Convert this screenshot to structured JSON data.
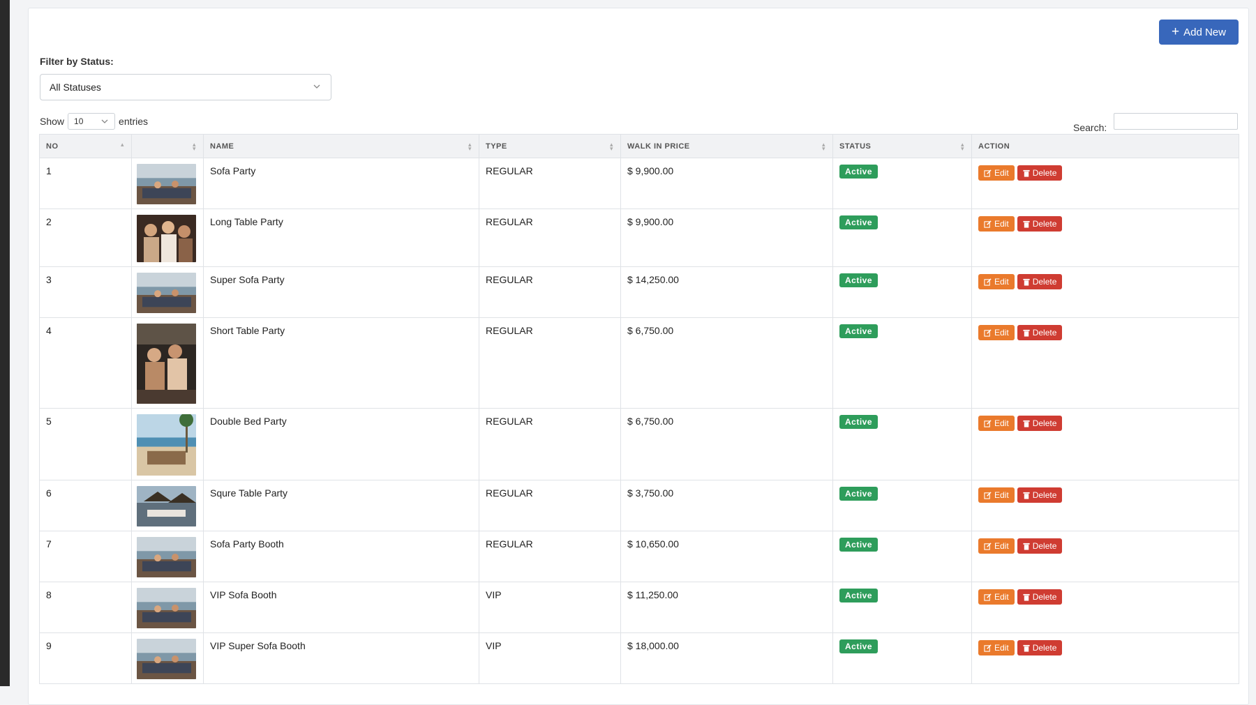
{
  "toolbar": {
    "add_label": "Add New"
  },
  "filter": {
    "label": "Filter by Status:",
    "selected": "All Statuses"
  },
  "length": {
    "show": "Show",
    "value": "10",
    "entries": "entries"
  },
  "search": {
    "label": "Search:"
  },
  "table": {
    "headers": [
      "NO",
      "",
      "NAME",
      "TYPE",
      "WALK IN PRICE",
      "STATUS",
      "ACTION"
    ],
    "edit_label": "Edit",
    "delete_label": "Delete",
    "rows": [
      {
        "no": "1",
        "name": "Sofa Party",
        "type": "REGULAR",
        "price": "$ 9,900.00",
        "status": "Active"
      },
      {
        "no": "2",
        "name": "Long Table Party",
        "type": "REGULAR",
        "price": "$ 9,900.00",
        "status": "Active"
      },
      {
        "no": "3",
        "name": "Super Sofa Party",
        "type": "REGULAR",
        "price": "$ 14,250.00",
        "status": "Active"
      },
      {
        "no": "4",
        "name": "Short Table Party",
        "type": "REGULAR",
        "price": "$ 6,750.00",
        "status": "Active"
      },
      {
        "no": "5",
        "name": "Double Bed Party",
        "type": "REGULAR",
        "price": "$ 6,750.00",
        "status": "Active"
      },
      {
        "no": "6",
        "name": "Squre Table Party",
        "type": "REGULAR",
        "price": "$ 3,750.00",
        "status": "Active"
      },
      {
        "no": "7",
        "name": "Sofa Party Booth",
        "type": "REGULAR",
        "price": "$ 10,650.00",
        "status": "Active"
      },
      {
        "no": "8",
        "name": "VIP Sofa Booth",
        "type": "VIP",
        "price": "$ 11,250.00",
        "status": "Active"
      },
      {
        "no": "9",
        "name": "VIP Super Sofa Booth",
        "type": "VIP",
        "price": "$ 18,000.00",
        "status": "Active"
      }
    ]
  },
  "colors": {
    "primary": "#3867bb",
    "success": "#2e9d5b",
    "warning": "#ea7a2c",
    "danger": "#cf3c32"
  }
}
